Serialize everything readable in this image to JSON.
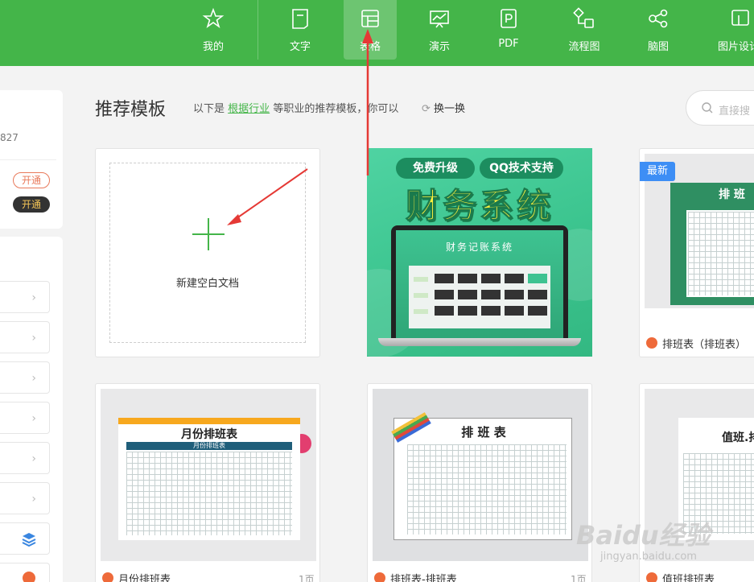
{
  "nav": {
    "items": [
      {
        "label": "我的",
        "icon": "star-icon"
      },
      {
        "label": "文字",
        "icon": "document-icon"
      },
      {
        "label": "表格",
        "icon": "table-icon"
      },
      {
        "label": "演示",
        "icon": "presentation-icon"
      },
      {
        "label": "PDF",
        "icon": "pdf-icon"
      },
      {
        "label": "流程图",
        "icon": "flowchart-icon"
      },
      {
        "label": "脑图",
        "icon": "mindmap-icon"
      },
      {
        "label": "图片设计",
        "icon": "image-design-icon"
      }
    ],
    "active": "表格"
  },
  "sidebar": {
    "user_number": "827",
    "open_label_1": "开通",
    "open_label_2": "开通"
  },
  "main": {
    "heading": "推荐模板",
    "sub_prefix": "以下是",
    "sub_link": "根据行业",
    "sub_suffix": "等职业的推荐模板，你可以",
    "refresh_label": "换一换",
    "search_placeholder": "直接搜"
  },
  "cards": {
    "blank_label": "新建空白文档",
    "finance": {
      "pill_1": "免费升级",
      "pill_2": "QQ技术支持",
      "title": "财务系统",
      "screen_title": "财务记账系统"
    },
    "shift1": {
      "badge": "最新",
      "thumb_title": "排 班",
      "title": "排班表（排班表）"
    },
    "monthly": {
      "thumb_title": "月份排班表",
      "thumb_subtitle": "月份排班表",
      "title": "月份排班表",
      "pages": "1页"
    },
    "shift2": {
      "thumb_title": "排 班 表",
      "title": "排班表-排班表",
      "pages": "1页"
    },
    "duty": {
      "thumb_title": "值班.排",
      "title": "值班排班表"
    }
  },
  "watermark": {
    "logo": "Baidu经验",
    "url": "jingyan.baidu.com"
  },
  "colors": {
    "brand_green": "#44b549",
    "arrow_red": "#e53935",
    "badge_blue": "#3d8ef5"
  }
}
